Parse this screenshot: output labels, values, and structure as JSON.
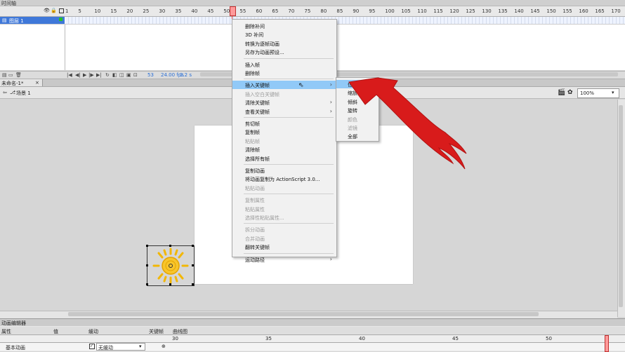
{
  "timeline": {
    "title": "时间轴",
    "ruler": [
      "1",
      "5",
      "10",
      "15",
      "20",
      "25",
      "30",
      "35",
      "40",
      "45",
      "50",
      "55",
      "60",
      "65",
      "70",
      "75",
      "80",
      "85",
      "90",
      "95",
      "100",
      "105",
      "110",
      "115",
      "120",
      "125",
      "130",
      "135",
      "140",
      "145",
      "150",
      "155",
      "160",
      "165",
      "170"
    ],
    "layer_name": "图层 1",
    "layer_num": "1",
    "fps": "24.00 fps",
    "frame": "53",
    "time": "2.2 s"
  },
  "document": {
    "tab_label": "未命名-1*",
    "scene": "场景 1",
    "zoom": "100%"
  },
  "context_menu": {
    "items": [
      {
        "label": "删除补间",
        "disabled": false
      },
      {
        "label": "3D 补间",
        "disabled": false
      },
      {
        "label": "转换为逐帧动画",
        "disabled": false
      },
      {
        "label": "另存为动画预设...",
        "disabled": false
      },
      {
        "label": "插入帧",
        "disabled": false
      },
      {
        "label": "删除帧",
        "disabled": false
      },
      {
        "label": "插入关键帧",
        "disabled": false,
        "submenu": true,
        "highlight": true
      },
      {
        "label": "插入空白关键帧",
        "disabled": true
      },
      {
        "label": "清除关键帧",
        "disabled": false,
        "submenu": true
      },
      {
        "label": "查看关键帧",
        "disabled": false,
        "submenu": true
      },
      {
        "label": "剪切帧",
        "disabled": false
      },
      {
        "label": "复制帧",
        "disabled": false
      },
      {
        "label": "粘贴帧",
        "disabled": true
      },
      {
        "label": "清除帧",
        "disabled": false
      },
      {
        "label": "选择所有帧",
        "disabled": false
      },
      {
        "label": "复制动画",
        "disabled": false
      },
      {
        "label": "将动画复制为 ActionScript 3.0...",
        "disabled": false
      },
      {
        "label": "粘贴动画",
        "disabled": true
      },
      {
        "label": "复制属性",
        "disabled": true
      },
      {
        "label": "粘贴属性",
        "disabled": true
      },
      {
        "label": "选择性粘贴属性...",
        "disabled": true
      },
      {
        "label": "拆分动画",
        "disabled": true
      },
      {
        "label": "合并动画",
        "disabled": true
      },
      {
        "label": "翻转关键帧",
        "disabled": false
      },
      {
        "label": "运动路径",
        "disabled": false,
        "submenu": true
      }
    ]
  },
  "submenu": {
    "items": [
      {
        "label": "位置",
        "disabled": false,
        "highlight": true
      },
      {
        "label": "缩放",
        "disabled": false
      },
      {
        "label": "倾斜",
        "disabled": false
      },
      {
        "label": "旋转",
        "disabled": false
      },
      {
        "label": "颜色",
        "disabled": true
      },
      {
        "label": "滤镜",
        "disabled": true
      },
      {
        "label": "全部",
        "disabled": false
      }
    ]
  },
  "motion_editor": {
    "title": "动画编辑器",
    "col_property": "属性",
    "col_value": "值",
    "col_ease": "缓动",
    "col_keyframe": "关键帧",
    "col_graph": "曲线图",
    "row_label": "基本动画",
    "ease_value": "无缓动",
    "ruler": [
      "30",
      "35",
      "40",
      "45",
      "50"
    ]
  },
  "colors": {
    "highlight": "#91c9f7",
    "layer_selected": "#3f78d9",
    "arrow": "#d81b1b",
    "sun": "#f2b705"
  }
}
